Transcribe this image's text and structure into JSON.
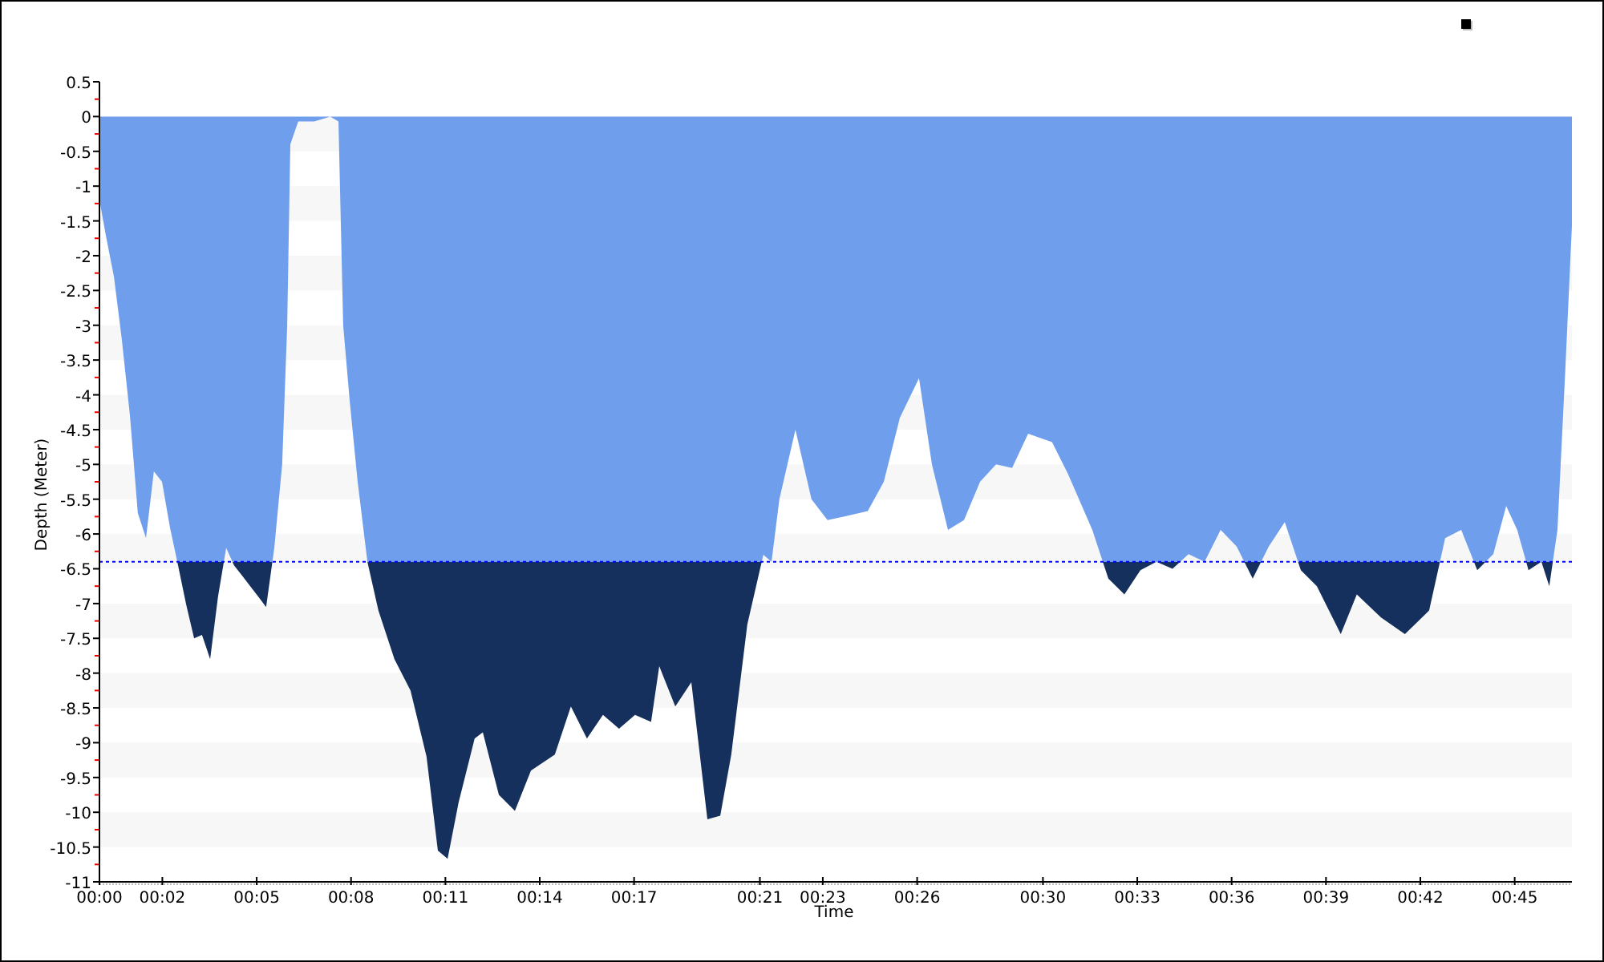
{
  "chart_data": {
    "type": "area",
    "xlabel": "Time",
    "ylabel": "Depth (Meter)",
    "x": [
      0,
      0.2,
      0.46,
      0.71,
      0.97,
      1.22,
      1.48,
      1.73,
      1.99,
      2.24,
      2.5,
      2.75,
      3.01,
      3.26,
      3.52,
      3.77,
      4.03,
      4.28,
      4.54,
      5.05,
      5.3,
      5.56,
      5.81,
      5.97,
      6.07,
      6.32,
      6.83,
      7.34,
      7.6,
      7.75,
      7.96,
      8.21,
      8.52,
      8.87,
      9.38,
      9.89,
      10.4,
      10.76,
      11.07,
      11.42,
      11.93,
      12.19,
      12.7,
      13.21,
      13.72,
      14.48,
      14.99,
      15.5,
      16.01,
      16.52,
      17.03,
      17.54,
      17.8,
      18.31,
      18.82,
      19.33,
      19.74,
      20.09,
      20.6,
      21.11,
      21.37,
      21.62,
      22.13,
      22.64,
      23.15,
      23.66,
      24.43,
      24.94,
      25.45,
      26.06,
      26.47,
      26.98,
      27.49,
      28,
      28.51,
      29.02,
      29.53,
      30.29,
      30.8,
      31.57,
      32.08,
      32.59,
      33.1,
      33.61,
      34.12,
      34.63,
      35.14,
      35.65,
      36.16,
      36.67,
      37.18,
      37.69,
      38.2,
      38.71,
      39.47,
      39.98,
      40.75,
      41.51,
      42.28,
      42.79,
      43.3,
      43.81,
      44.32,
      44.73,
      45.08,
      45.44,
      45.85,
      46.1,
      46.36,
      46.61,
      46.82
    ],
    "series": [
      {
        "color": "#6f9fec",
        "values": [
          -1.2,
          -1.7,
          -2.3,
          -3.2,
          -4.3,
          -5.7,
          -6.06,
          -5.1,
          -5.25,
          -5.9,
          -6.45,
          -7,
          -7.5,
          -7.45,
          -7.8,
          -6.9,
          -6.2,
          -6.45,
          -6.6,
          -6.9,
          -7.05,
          -6.2,
          -5,
          -3,
          -0.4,
          -0.07,
          -0.07,
          0,
          -0.07,
          -3,
          -4.1,
          -5.25,
          -6.4,
          -7.1,
          -7.8,
          -8.25,
          -9.2,
          -10.55,
          -10.67,
          -9.86,
          -8.94,
          -8.85,
          -9.75,
          -9.98,
          -9.4,
          -9.17,
          -8.48,
          -8.94,
          -8.6,
          -8.8,
          -8.6,
          -8.7,
          -7.9,
          -8.48,
          -8.13,
          -10.1,
          -10.05,
          -9.17,
          -7.3,
          -6.3,
          -6.4,
          -5.5,
          -4.5,
          -5.5,
          -5.8,
          -5.75,
          -5.67,
          -5.25,
          -4.33,
          -3.76,
          -5,
          -5.94,
          -5.8,
          -5.25,
          -5,
          -5.05,
          -4.56,
          -4.68,
          -5.14,
          -5.94,
          -6.64,
          -6.87,
          -6.52,
          -6.4,
          -6.5,
          -6.29,
          -6.4,
          -5.94,
          -6.18,
          -6.64,
          -6.18,
          -5.83,
          -6.52,
          -6.75,
          -7.44,
          -6.87,
          -7.2,
          -7.44,
          -7.1,
          -6.06,
          -5.94,
          -6.52,
          -6.29,
          -5.6,
          -5.94,
          -6.52,
          -6.4,
          -6.75,
          -5.94,
          -3.64,
          -1.57
        ]
      }
    ],
    "xlim": [
      0,
      46.82
    ],
    "ylim": [
      -11,
      0.5
    ],
    "xticks": [
      {
        "value": 0,
        "label": "00:00"
      },
      {
        "value": 2,
        "label": "00:02"
      },
      {
        "value": 5,
        "label": "00:05"
      },
      {
        "value": 8,
        "label": "00:08"
      },
      {
        "value": 11,
        "label": "00:11"
      },
      {
        "value": 14,
        "label": "00:14"
      },
      {
        "value": 17,
        "label": "00:17"
      },
      {
        "value": 21,
        "label": "00:21"
      },
      {
        "value": 23,
        "label": "00:23"
      },
      {
        "value": 26,
        "label": "00:26"
      },
      {
        "value": 30,
        "label": "00:30"
      },
      {
        "value": 33,
        "label": "00:33"
      },
      {
        "value": 36,
        "label": "00:36"
      },
      {
        "value": 39,
        "label": "00:39"
      },
      {
        "value": 42,
        "label": "00:42"
      },
      {
        "value": 45,
        "label": "00:45"
      }
    ],
    "yticks": [
      0.5,
      0,
      -0.5,
      -1,
      -1.5,
      -2,
      -2.5,
      -3,
      -3.5,
      -4,
      -4.5,
      -5,
      -5.5,
      -6,
      -6.5,
      -7,
      -7.5,
      -8,
      -8.5,
      -9,
      -9.5,
      -10,
      -10.5,
      -11
    ],
    "ref_lines": [
      {
        "axis": "y",
        "value": -6.4,
        "color": "#0000ff"
      }
    ]
  }
}
